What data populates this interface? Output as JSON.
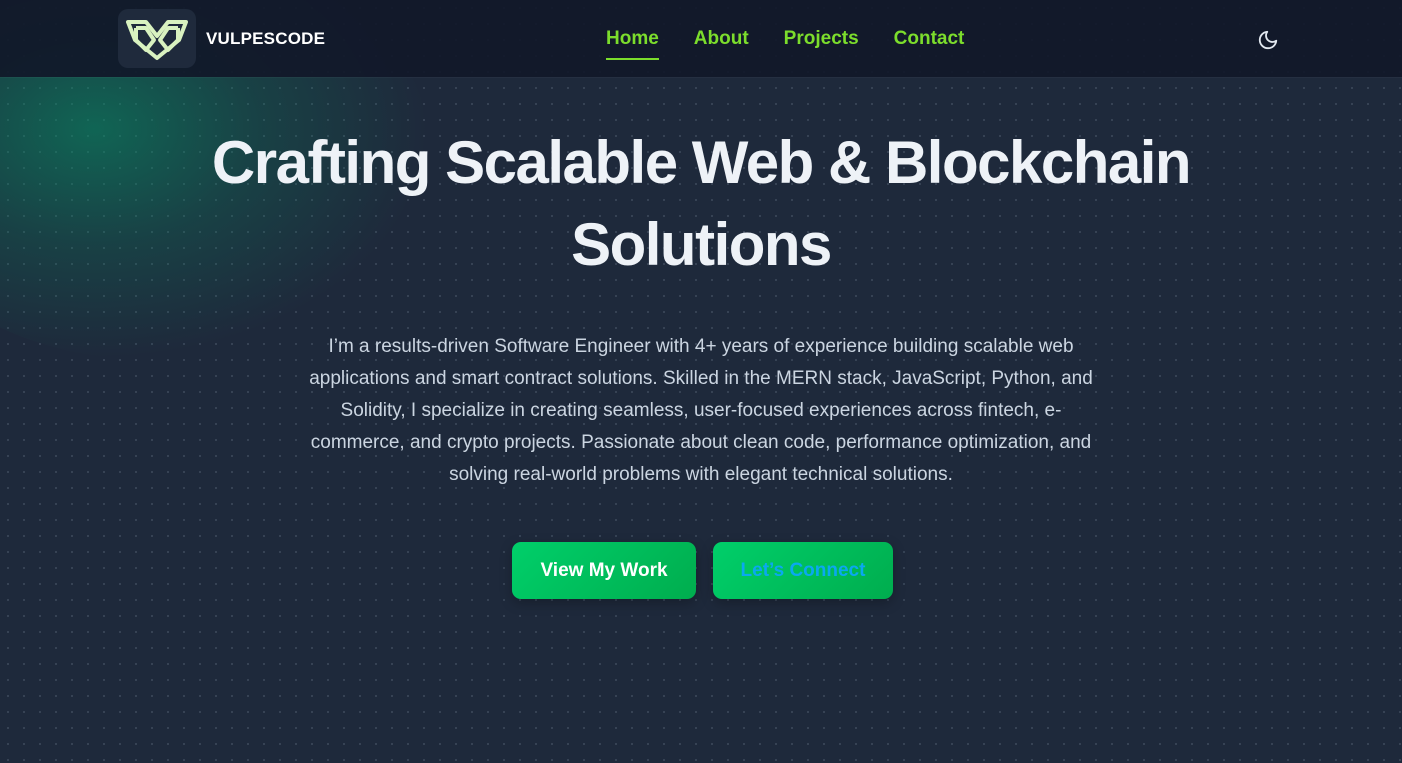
{
  "brand": {
    "name": "VULPESCODE",
    "logo_icon": "fox-logo-icon"
  },
  "nav": {
    "items": [
      {
        "label": "Home",
        "active": true
      },
      {
        "label": "About",
        "active": false
      },
      {
        "label": "Projects",
        "active": false
      },
      {
        "label": "Contact",
        "active": false
      }
    ],
    "theme_toggle_icon": "moon-icon"
  },
  "hero": {
    "title_line1": "Crafting Scalable Web & Blockchain",
    "title_line2": "Solutions",
    "description": "I’m a results-driven Software Engineer with 4+ years of experience building scalable web applications and smart contract solutions. Skilled in the MERN stack, JavaScript, Python, and Solidity, I specialize in creating seamless, user-focused experiences across fintech, e-commerce, and crypto projects. Passionate about clean code, performance optimization, and solving real-world problems with elegant technical solutions.",
    "primary_cta": "View My Work",
    "secondary_cta": "Let’s Connect"
  },
  "colors": {
    "background": "#1e293b",
    "navbar": "#111829",
    "nav_link": "#7cdd2c",
    "button_gradient_start": "#00cf6a",
    "button_gradient_end": "#00ad4e",
    "secondary_button_text": "#0aa8f0",
    "glow": "#059669"
  }
}
